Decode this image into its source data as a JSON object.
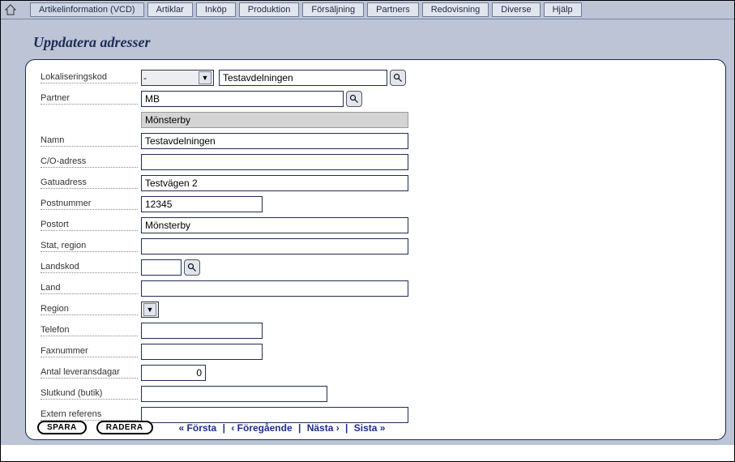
{
  "menu": {
    "items": [
      "Artikelinformation (VCD)",
      "Artiklar",
      "Inköp",
      "Produktion",
      "Försäljning",
      "Partners",
      "Redovisning",
      "Diverse",
      "Hjälp"
    ]
  },
  "page": {
    "title": "Uppdatera adresser"
  },
  "form": {
    "lokaliseringskod": {
      "label": "Lokaliseringskod",
      "select_value": "-",
      "text_value": "Testavdelningen"
    },
    "partner": {
      "label": "Partner",
      "value": "MB",
      "readonly_value": "Mönsterby"
    },
    "namn": {
      "label": "Namn",
      "value": "Testavdelningen"
    },
    "co_adress": {
      "label": "C/O-adress",
      "value": ""
    },
    "gatuadress": {
      "label": "Gatuadress",
      "value": "Testvägen 2"
    },
    "postnummer": {
      "label": "Postnummer",
      "value": "12345"
    },
    "postort": {
      "label": "Postort",
      "value": "Mönsterby"
    },
    "stat_region": {
      "label": "Stat, region",
      "value": ""
    },
    "landskod": {
      "label": "Landskod",
      "value": ""
    },
    "land": {
      "label": "Land",
      "value": ""
    },
    "region": {
      "label": "Region",
      "value": ""
    },
    "telefon": {
      "label": "Telefon",
      "value": ""
    },
    "faxnummer": {
      "label": "Faxnummer",
      "value": ""
    },
    "antal_leveransdagar": {
      "label": "Antal leveransdagar",
      "value": "0"
    },
    "slutkund": {
      "label": "Slutkund (butik)",
      "value": ""
    },
    "extern_referens": {
      "label": "Extern referens",
      "value": ""
    }
  },
  "footer": {
    "save": "SPARA",
    "delete": "RADERA",
    "first": "« Första",
    "prev": "‹ Föregående",
    "next": "Nästa ›",
    "last": "Sista »"
  }
}
